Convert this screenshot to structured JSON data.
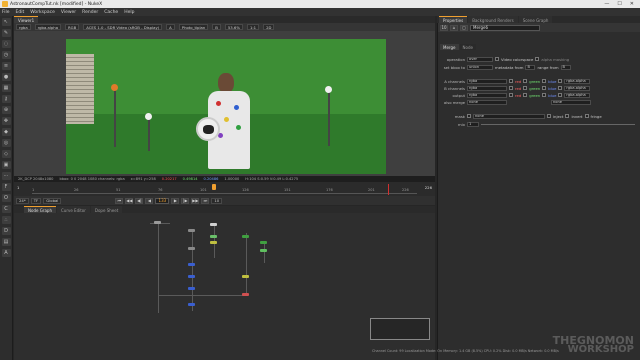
{
  "window": {
    "title": "AstronautCompTut.nk [modified] - NukeX",
    "controls": [
      "—",
      "☐",
      "✕"
    ]
  },
  "menubar": [
    "File",
    "Edit",
    "Workspace",
    "Viewer",
    "Render",
    "Cache",
    "Help"
  ],
  "left_toolbar_icons": [
    "pointer-icon",
    "paint-icon",
    "draw-icon",
    "time-icon",
    "channel-icon",
    "color-icon",
    "filter-icon",
    "keyer-icon",
    "merge-icon",
    "transform-icon",
    "3d-icon",
    "views-icon",
    "metadata-icon",
    "toolsets-icon",
    "other-icon",
    "furnace-icon",
    "ocula-icon",
    "cara-icon",
    "particles-icon",
    "deep-icon",
    "image-icon",
    "airoot-icon"
  ],
  "viewer": {
    "tab_label": "Viewer1",
    "controls": {
      "channels": "rgba",
      "layer": "rgba.alpha",
      "rgb": "RGB",
      "colorspace": "ACES 1.0 - SDR Video (sRGB - Display)",
      "mode": "A",
      "node": "Photo_tiplan",
      "b_input": "B",
      "zoom": "53.6%",
      "ratio": "1:1",
      "proxy": "2D"
    },
    "info": {
      "format": "2K_DCP 2048x1080",
      "bbox": "bbox: 0 0 2048 1080 channels: rgba",
      "coords": "x=891 y=258",
      "r": "0.20217",
      "g": "0.49814",
      "b": "0.20486",
      "a": "1.00000",
      "hsv": "H:104 S:0.59 V:0.49 L:0.4275"
    }
  },
  "timeline": {
    "ticks": [
      "1",
      "26",
      "51",
      "76",
      "101",
      "126",
      "151",
      "176",
      "201",
      "226"
    ],
    "start": "1",
    "end": "226",
    "current_frame": "133",
    "fps_label": "24*",
    "mode": "TF",
    "global": "Global",
    "increment": "10"
  },
  "transport": [
    "⏮",
    "◀◀",
    "◀|",
    "◀",
    "▶",
    "|▶",
    "▶▶",
    "⏭"
  ],
  "node_graph_tabs": [
    "Node Graph",
    "Curve Editor",
    "Dope Sheet"
  ],
  "properties": {
    "tabs": [
      "Properties",
      "Background Renders",
      "Scene Graph"
    ],
    "node_name": "Merge6",
    "subtabs": [
      "Merge",
      "Node"
    ],
    "operation_label": "operation",
    "operation_value": "over",
    "video_colorspace": "Video colorspace",
    "alpha_masking": "alpha masking",
    "set_bbox_label": "set bbox to",
    "set_bbox_value": "union",
    "metadata_label": "metadata from",
    "metadata_value": "B",
    "range_label": "range from",
    "range_value": "B",
    "a_channels_label": "A channels",
    "a_channels_value": "rgba",
    "b_channels_label": "B channels",
    "b_channels_value": "rgba",
    "output_label": "output",
    "output_value": "rgba",
    "also_merge_label": "also merge",
    "also_merge_value": "none",
    "also_merge_second": "none",
    "chan_labels": {
      "red": "red",
      "green": "green",
      "blue": "blue",
      "alpha": "rgba.alpha"
    },
    "mask_label": "mask",
    "mask_value": "none",
    "inject": "inject",
    "invert": "invert",
    "fringe": "fringe",
    "mix_label": "mix",
    "mix_value": "1"
  },
  "statusbar": "Channel Count: 99 Localization Mode: On Memory: 1.4 GB (8.5%) CPU: 0.2% Disk: 0.0 MB/s Network: 0.0 MB/s",
  "watermark": {
    "line1": "THEGNOMON",
    "line2": "WORKSHOP"
  },
  "colors": {
    "accent": "#f0a030",
    "green_screen": "#3d8e35",
    "panel": "#2d2d2d"
  }
}
